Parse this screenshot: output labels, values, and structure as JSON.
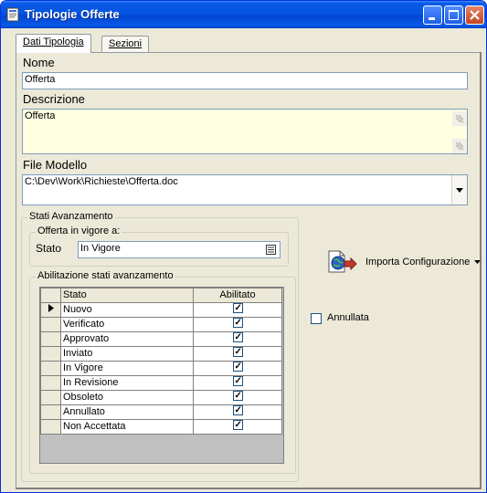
{
  "window": {
    "title": "Tipologie Offerte",
    "icon": "app-window-icon"
  },
  "tabs": [
    {
      "label": "Dati Tipologia",
      "active": true
    },
    {
      "label": "Sezioni",
      "active": false
    }
  ],
  "nome": {
    "label": "Nome",
    "value": "Offerta"
  },
  "descrizione": {
    "label": "Descrizione",
    "value": "Offerta"
  },
  "file_modello": {
    "label": "File Modello",
    "value": "C:\\Dev\\Work\\Richieste\\Offerta.doc"
  },
  "stati": {
    "group_label": "Stati Avanzamento",
    "vigore_label": "Offerta in vigore a:",
    "stato_label": "Stato",
    "stato_value": "In Vigore",
    "abilitazione_label": "Abilitazione stati avanzamento",
    "columns": [
      "Stato",
      "Abilitato"
    ],
    "rows": [
      {
        "stato": "Nuovo",
        "abilitato": true,
        "current": true
      },
      {
        "stato": "Verificato",
        "abilitato": true
      },
      {
        "stato": "Approvato",
        "abilitato": true
      },
      {
        "stato": "Inviato",
        "abilitato": true
      },
      {
        "stato": "In Vigore",
        "abilitato": true
      },
      {
        "stato": "In Revisione",
        "abilitato": true
      },
      {
        "stato": "Obsoleto",
        "abilitato": true
      },
      {
        "stato": "Annullato",
        "abilitato": true
      },
      {
        "stato": "Non Accettata",
        "abilitato": true
      }
    ]
  },
  "import_button": {
    "label": "Importa Configurazione"
  },
  "annullata": {
    "label": "Annullata",
    "checked": false
  },
  "colors": {
    "titlebar": "#0554e3",
    "window_bg": "#ece9d8",
    "memo_bg": "#ffffe1"
  }
}
